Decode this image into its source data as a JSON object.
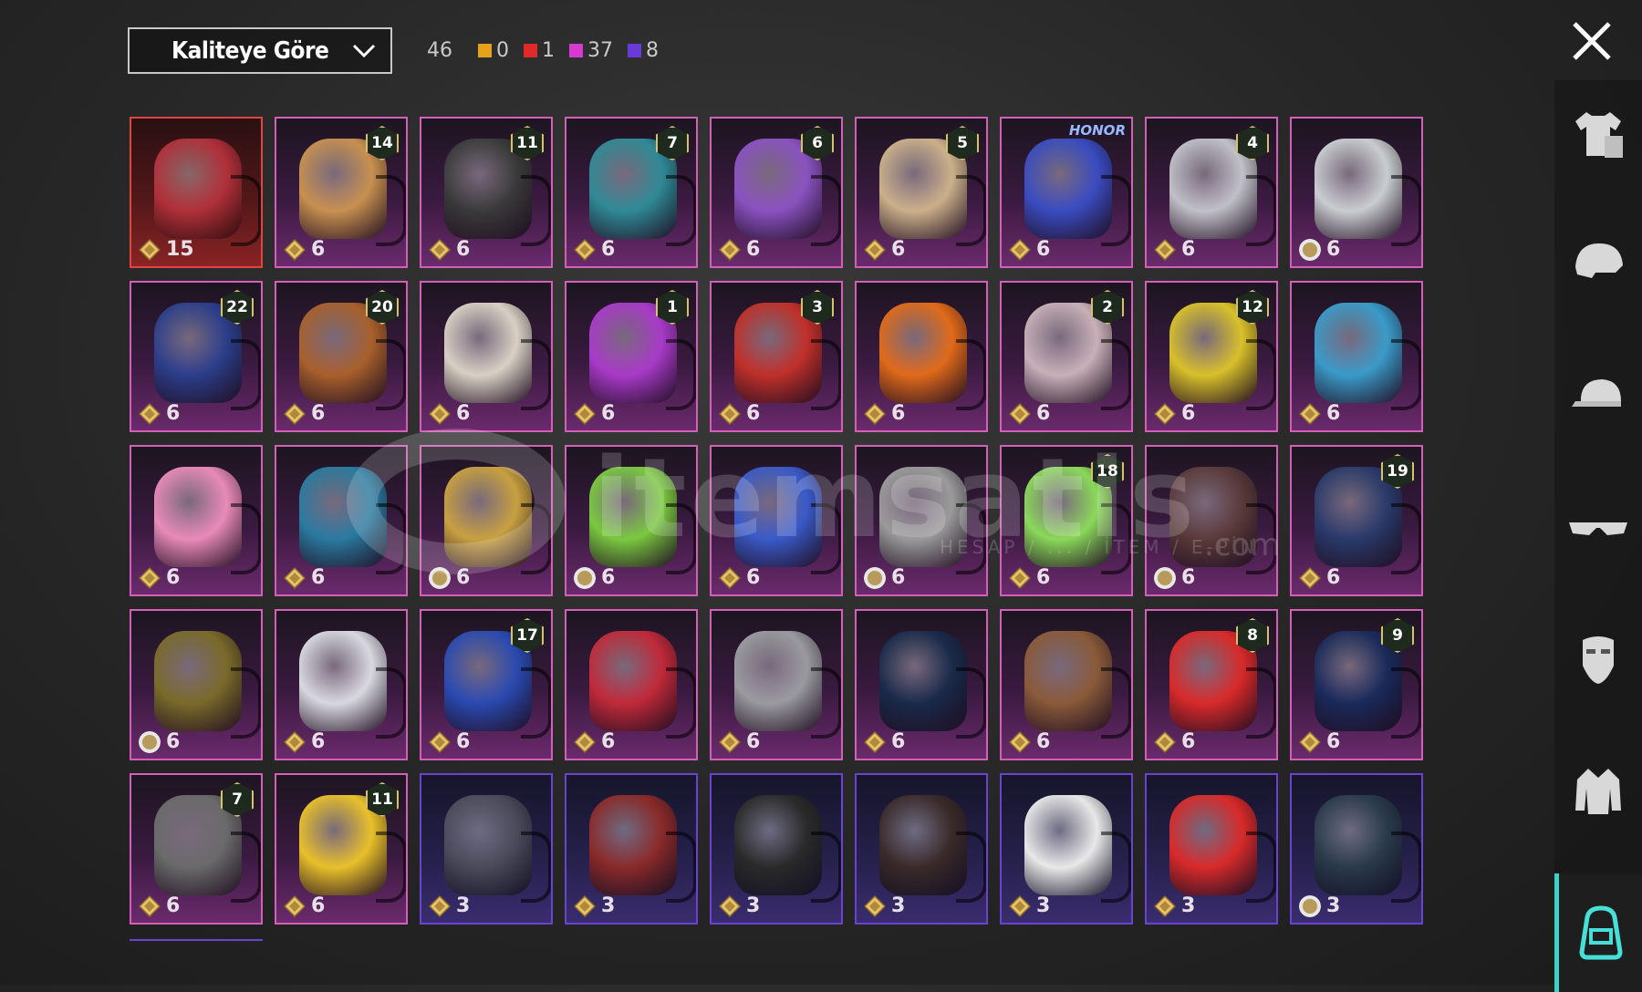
{
  "toolbar": {
    "sort_label": "Kaliteye Göre",
    "total": "46",
    "quality_counts": [
      {
        "color": "#e5a21a",
        "value": "0"
      },
      {
        "color": "#e02a2a",
        "value": "1"
      },
      {
        "color": "#d63bd0",
        "value": "37"
      },
      {
        "color": "#6a3ad8",
        "value": "8"
      }
    ]
  },
  "rail_icons": [
    "shirt-icon",
    "helmet-icon",
    "cap-icon",
    "glasses-icon",
    "mask-icon",
    "jacket-icon",
    "backpack-icon"
  ],
  "rail_active": "backpack-icon",
  "watermark": {
    "name": "itemsatis",
    "sub": "HESAP / ... / İTEM / E-PİN",
    "domain": ".com"
  },
  "items": [
    {
      "rarity": "red",
      "price": "15",
      "level": "",
      "color": "#b0303a"
    },
    {
      "rarity": "purple",
      "price": "6",
      "level": "14",
      "color": "#c89050"
    },
    {
      "rarity": "purple",
      "price": "6",
      "level": "11",
      "color": "#3a3a3a"
    },
    {
      "rarity": "purple",
      "price": "6",
      "level": "7",
      "color": "#2f8a96"
    },
    {
      "rarity": "purple",
      "price": "6",
      "level": "6",
      "color": "#8a52c0"
    },
    {
      "rarity": "purple",
      "price": "6",
      "level": "5",
      "color": "#cbb08a"
    },
    {
      "rarity": "purple",
      "price": "6",
      "level": "",
      "tag": "HONOR",
      "color": "#3a4cc0"
    },
    {
      "rarity": "purple",
      "price": "6",
      "level": "4",
      "color": "#c0c0c8"
    },
    {
      "rarity": "purple",
      "price": "6",
      "level": "",
      "coin": "alt",
      "color": "#c9cdd0"
    },
    {
      "rarity": "purple",
      "price": "6",
      "level": "22",
      "color": "#2c3e8a"
    },
    {
      "rarity": "purple",
      "price": "6",
      "level": "20",
      "color": "#a8602c"
    },
    {
      "rarity": "purple",
      "price": "6",
      "level": "",
      "color": "#d8d0c4"
    },
    {
      "rarity": "purple",
      "price": "6",
      "level": "1",
      "color": "#a83ac8"
    },
    {
      "rarity": "purple",
      "price": "6",
      "level": "3",
      "color": "#c0302a"
    },
    {
      "rarity": "purple",
      "price": "6",
      "level": "",
      "color": "#e06a1a"
    },
    {
      "rarity": "purple",
      "price": "6",
      "level": "2",
      "color": "#c8b0b8"
    },
    {
      "rarity": "purple",
      "price": "6",
      "level": "12",
      "color": "#d8c02a"
    },
    {
      "rarity": "purple",
      "price": "6",
      "level": "",
      "color": "#3a9ac8"
    },
    {
      "rarity": "purple",
      "price": "6",
      "level": "",
      "color": "#e88ab8"
    },
    {
      "rarity": "purple",
      "price": "6",
      "level": "",
      "color": "#2a7aa0"
    },
    {
      "rarity": "purple",
      "price": "6",
      "level": "",
      "coin": "alt",
      "color": "#c8a040"
    },
    {
      "rarity": "purple",
      "price": "6",
      "level": "",
      "coin": "alt",
      "color": "#7ac840"
    },
    {
      "rarity": "purple",
      "price": "6",
      "level": "",
      "color": "#3a5ac8"
    },
    {
      "rarity": "purple",
      "price": "6",
      "level": "",
      "coin": "alt",
      "color": "#9a9a9a"
    },
    {
      "rarity": "purple",
      "price": "6",
      "level": "18",
      "color": "#8ad85a"
    },
    {
      "rarity": "purple",
      "price": "6",
      "level": "",
      "coin": "alt",
      "color": "#5a3a3a"
    },
    {
      "rarity": "purple",
      "price": "6",
      "level": "19",
      "color": "#2a3a6a"
    },
    {
      "rarity": "purple",
      "price": "6",
      "level": "",
      "coin": "alt",
      "color": "#7a6a2a"
    },
    {
      "rarity": "purple",
      "price": "6",
      "level": "",
      "color": "#d8d8e0"
    },
    {
      "rarity": "purple",
      "price": "6",
      "level": "17",
      "color": "#2a4ab0"
    },
    {
      "rarity": "purple",
      "price": "6",
      "level": "",
      "color": "#c02a3a"
    },
    {
      "rarity": "purple",
      "price": "6",
      "level": "",
      "color": "#9a9aa0"
    },
    {
      "rarity": "purple",
      "price": "6",
      "level": "",
      "color": "#1a2a4a"
    },
    {
      "rarity": "purple",
      "price": "6",
      "level": "",
      "color": "#8a5a3a"
    },
    {
      "rarity": "purple",
      "price": "6",
      "level": "8",
      "color": "#d82a2a"
    },
    {
      "rarity": "purple",
      "price": "6",
      "level": "9",
      "color": "#1a2a5a"
    },
    {
      "rarity": "purple",
      "price": "6",
      "level": "7",
      "color": "#6a6a6a"
    },
    {
      "rarity": "purple",
      "price": "6",
      "level": "11",
      "color": "#e8c02a"
    },
    {
      "rarity": "blue",
      "price": "3",
      "level": "",
      "color": "#4a4a5a"
    },
    {
      "rarity": "blue",
      "price": "3",
      "level": "",
      "color": "#8a2a2a"
    },
    {
      "rarity": "blue",
      "price": "3",
      "level": "",
      "color": "#2a2a2a"
    },
    {
      "rarity": "blue",
      "price": "3",
      "level": "",
      "color": "#3a2a2a"
    },
    {
      "rarity": "blue",
      "price": "3",
      "level": "",
      "color": "#e8e8e8"
    },
    {
      "rarity": "blue",
      "price": "3",
      "level": "",
      "color": "#d82a2a"
    },
    {
      "rarity": "blue",
      "price": "3",
      "level": "",
      "coin": "alt",
      "color": "#2a3a4a"
    }
  ]
}
